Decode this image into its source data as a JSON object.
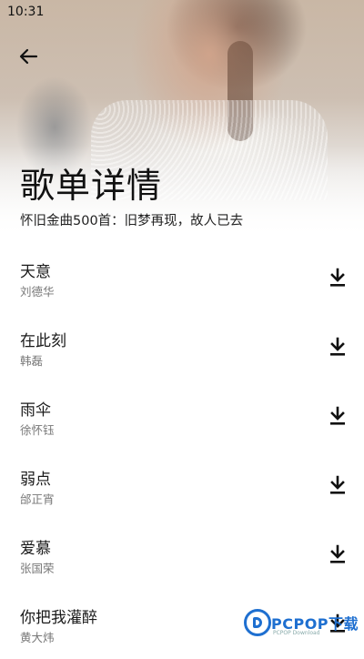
{
  "status_bar": {
    "time": "10:31"
  },
  "header": {
    "back_icon": "arrow-left-icon",
    "title": "歌单详情",
    "subtitle": "怀旧金曲500首：旧梦再现，故人已去"
  },
  "songs": [
    {
      "title": "天意",
      "artist": "刘德华"
    },
    {
      "title": "在此刻",
      "artist": "韩磊"
    },
    {
      "title": "雨伞",
      "artist": "徐怀钰"
    },
    {
      "title": "弱点",
      "artist": "邰正宵"
    },
    {
      "title": "爱慕",
      "artist": "张国荣"
    },
    {
      "title": "你把我灌醉",
      "artist": "黄大炜"
    }
  ],
  "download_icon": "download-icon",
  "watermark": {
    "text": "PCPOP下载",
    "sub": "PCPOP Download"
  },
  "colors": {
    "title": "#111111",
    "artist": "#777777",
    "watermark": "#1e6fd0"
  }
}
